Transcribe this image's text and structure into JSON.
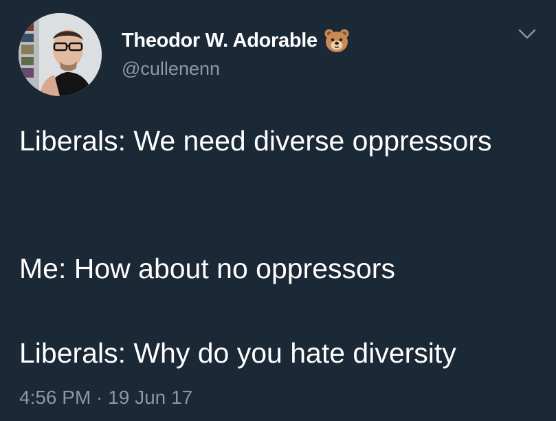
{
  "user": {
    "display_name": "Theodor W. Adorable",
    "handle": "@cullenenn",
    "badge_icon": "bear-face-emoji"
  },
  "tweet": {
    "paragraphs": [
      "Liberals: We need diverse oppressors",
      "Me: How about no oppressors",
      "Liberals: Why do you hate diversity"
    ],
    "timestamp": "4:56 PM · 19 Jun 17"
  },
  "theme": {
    "background": "#1b2836",
    "text_primary": "#ffffff",
    "text_secondary": "#8899a6"
  }
}
